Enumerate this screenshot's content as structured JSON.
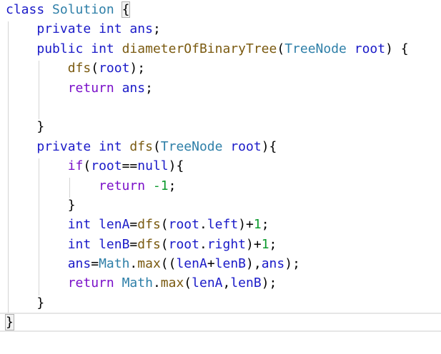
{
  "theme": {
    "keyword": "#7a10c9",
    "type": "#1a1ac8",
    "class_name": "#2e7fa8",
    "method": "#7a5a10",
    "number": "#0d9a2e",
    "plain": "#000000"
  },
  "lines": [
    [
      {
        "t": "class",
        "c": "type"
      },
      {
        "t": " "
      },
      {
        "t": "Solution",
        "c": "class_name"
      },
      {
        "t": " "
      },
      {
        "t": "{",
        "c": "plain",
        "hl": true
      }
    ],
    [
      {
        "t": "    "
      },
      {
        "t": "private",
        "c": "type"
      },
      {
        "t": " "
      },
      {
        "t": "int",
        "c": "type"
      },
      {
        "t": " "
      },
      {
        "t": "ans",
        "c": "type"
      },
      {
        "t": ";"
      }
    ],
    [
      {
        "t": "    "
      },
      {
        "t": "public",
        "c": "type"
      },
      {
        "t": " "
      },
      {
        "t": "int",
        "c": "type"
      },
      {
        "t": " "
      },
      {
        "t": "diameterOfBinaryTree",
        "c": "method"
      },
      {
        "t": "("
      },
      {
        "t": "TreeNode",
        "c": "class_name"
      },
      {
        "t": " "
      },
      {
        "t": "root",
        "c": "type"
      },
      {
        "t": ") {"
      }
    ],
    [
      {
        "t": "        "
      },
      {
        "t": "dfs",
        "c": "method"
      },
      {
        "t": "("
      },
      {
        "t": "root",
        "c": "type"
      },
      {
        "t": ");"
      }
    ],
    [
      {
        "t": "        "
      },
      {
        "t": "return",
        "c": "keyword"
      },
      {
        "t": " "
      },
      {
        "t": "ans",
        "c": "type"
      },
      {
        "t": ";"
      }
    ],
    [
      {
        "t": ""
      }
    ],
    [
      {
        "t": "    }"
      }
    ],
    [
      {
        "t": "    "
      },
      {
        "t": "private",
        "c": "type"
      },
      {
        "t": " "
      },
      {
        "t": "int",
        "c": "type"
      },
      {
        "t": " "
      },
      {
        "t": "dfs",
        "c": "method"
      },
      {
        "t": "("
      },
      {
        "t": "TreeNode",
        "c": "class_name"
      },
      {
        "t": " "
      },
      {
        "t": "root",
        "c": "type"
      },
      {
        "t": "){"
      }
    ],
    [
      {
        "t": "        "
      },
      {
        "t": "if",
        "c": "keyword"
      },
      {
        "t": "("
      },
      {
        "t": "root",
        "c": "type"
      },
      {
        "t": "=="
      },
      {
        "t": "null",
        "c": "type"
      },
      {
        "t": "){"
      }
    ],
    [
      {
        "t": "            "
      },
      {
        "t": "return",
        "c": "keyword"
      },
      {
        "t": " "
      },
      {
        "t": "-1",
        "c": "number"
      },
      {
        "t": ";"
      }
    ],
    [
      {
        "t": "        }"
      }
    ],
    [
      {
        "t": "        "
      },
      {
        "t": "int",
        "c": "type"
      },
      {
        "t": " "
      },
      {
        "t": "lenA",
        "c": "type"
      },
      {
        "t": "="
      },
      {
        "t": "dfs",
        "c": "method"
      },
      {
        "t": "("
      },
      {
        "t": "root",
        "c": "type"
      },
      {
        "t": "."
      },
      {
        "t": "left",
        "c": "type"
      },
      {
        "t": ")+"
      },
      {
        "t": "1",
        "c": "number"
      },
      {
        "t": ";"
      }
    ],
    [
      {
        "t": "        "
      },
      {
        "t": "int",
        "c": "type"
      },
      {
        "t": " "
      },
      {
        "t": "lenB",
        "c": "type"
      },
      {
        "t": "="
      },
      {
        "t": "dfs",
        "c": "method"
      },
      {
        "t": "("
      },
      {
        "t": "root",
        "c": "type"
      },
      {
        "t": "."
      },
      {
        "t": "right",
        "c": "type"
      },
      {
        "t": ")+"
      },
      {
        "t": "1",
        "c": "number"
      },
      {
        "t": ";"
      }
    ],
    [
      {
        "t": "        "
      },
      {
        "t": "ans",
        "c": "type"
      },
      {
        "t": "="
      },
      {
        "t": "Math",
        "c": "class_name"
      },
      {
        "t": "."
      },
      {
        "t": "max",
        "c": "method"
      },
      {
        "t": "(("
      },
      {
        "t": "lenA",
        "c": "type"
      },
      {
        "t": "+"
      },
      {
        "t": "lenB",
        "c": "type"
      },
      {
        "t": "),"
      },
      {
        "t": "ans",
        "c": "type"
      },
      {
        "t": ");"
      }
    ],
    [
      {
        "t": "        "
      },
      {
        "t": "return",
        "c": "keyword"
      },
      {
        "t": " "
      },
      {
        "t": "Math",
        "c": "class_name"
      },
      {
        "t": "."
      },
      {
        "t": "max",
        "c": "method"
      },
      {
        "t": "("
      },
      {
        "t": "lenA",
        "c": "type"
      },
      {
        "t": ","
      },
      {
        "t": "lenB",
        "c": "type"
      },
      {
        "t": ");"
      }
    ],
    [
      {
        "t": "    }"
      }
    ],
    [
      {
        "t": "}",
        "hl": true
      }
    ]
  ]
}
